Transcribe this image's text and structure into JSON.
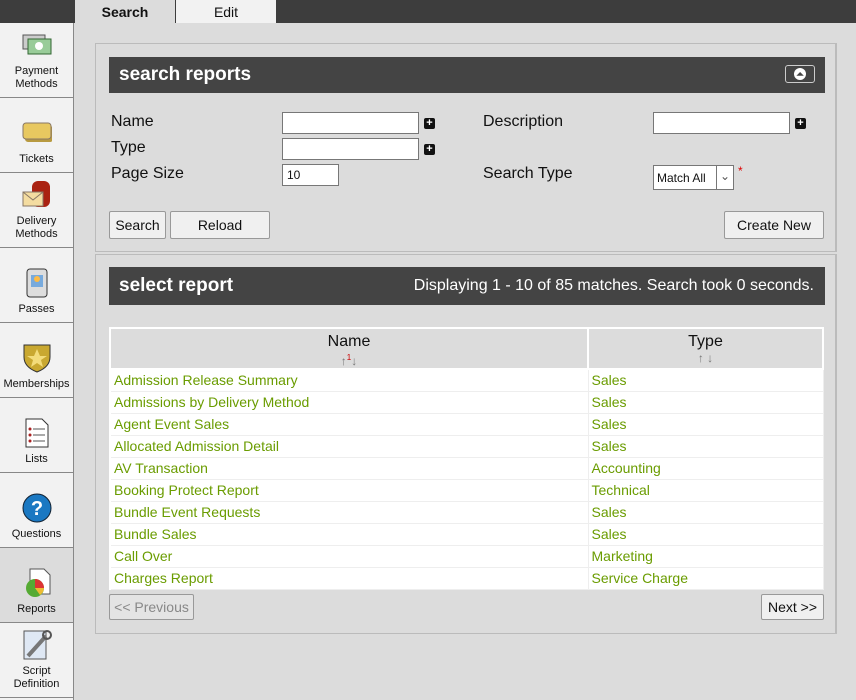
{
  "tabs": [
    {
      "label": "Search"
    },
    {
      "label": "Edit"
    }
  ],
  "sidebar": {
    "items": [
      {
        "label": "Payment Methods",
        "icon": "payment-icon"
      },
      {
        "label": "Tickets",
        "icon": "ticket-icon"
      },
      {
        "label": "Delivery Methods",
        "icon": "mailbox-icon"
      },
      {
        "label": "Passes",
        "icon": "pass-icon"
      },
      {
        "label": "Memberships",
        "icon": "shield-star-icon"
      },
      {
        "label": "Lists",
        "icon": "list-icon"
      },
      {
        "label": "Questions",
        "icon": "question-icon"
      },
      {
        "label": "Reports",
        "icon": "pie-chart-icon",
        "active": true
      },
      {
        "label": "Script Definition",
        "icon": "script-icon"
      }
    ]
  },
  "search": {
    "title": "search reports",
    "name_label": "Name",
    "name_value": "",
    "type_label": "Type",
    "type_value": "",
    "page_size_label": "Page Size",
    "page_size_value": "10",
    "description_label": "Description",
    "description_value": "",
    "search_type_label": "Search Type",
    "search_type_value": "Match All",
    "required_mark": "*",
    "search_button": "Search",
    "reload_button": "Reload",
    "create_button": "Create New"
  },
  "results": {
    "title": "select report",
    "status": "Displaying 1 - 10 of 85 matches. Search took 0 seconds.",
    "columns": [
      {
        "label": "Name",
        "sort_rank": "1"
      },
      {
        "label": "Type"
      }
    ],
    "rows": [
      {
        "name": "Admission Release Summary",
        "type": "Sales"
      },
      {
        "name": "Admissions by Delivery Method",
        "type": "Sales"
      },
      {
        "name": "Agent Event Sales",
        "type": "Sales"
      },
      {
        "name": "Allocated Admission Detail",
        "type": "Sales"
      },
      {
        "name": "AV Transaction",
        "type": "Accounting"
      },
      {
        "name": "Booking Protect Report",
        "type": "Technical"
      },
      {
        "name": "Bundle Event Requests",
        "type": "Sales"
      },
      {
        "name": "Bundle Sales",
        "type": "Sales"
      },
      {
        "name": "Call Over",
        "type": "Marketing"
      },
      {
        "name": "Charges Report",
        "type": "Service Charge"
      }
    ],
    "prev_button": "<< Previous",
    "next_button": "Next >>"
  },
  "colors": {
    "link": "#6a9c00",
    "header_bar": "#444444",
    "background": "#dcdcdc"
  }
}
